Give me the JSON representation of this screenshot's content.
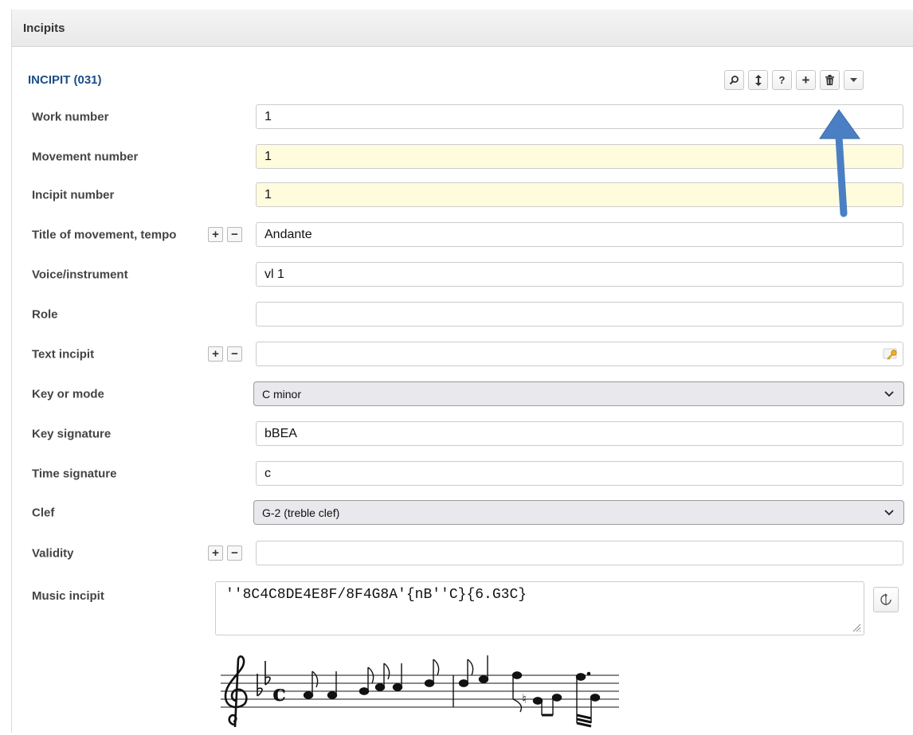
{
  "panel": {
    "title": "Incipits"
  },
  "section": {
    "title": "INCIPIT (031)"
  },
  "toolbar": {
    "buttons": [
      {
        "icon": "search-icon",
        "glyph": "⌕"
      },
      {
        "icon": "move-icon",
        "glyph": "↕"
      },
      {
        "icon": "help-icon",
        "glyph": "?"
      },
      {
        "icon": "plus-icon",
        "glyph": "+"
      },
      {
        "icon": "trash-icon",
        "glyph": "🗑"
      },
      {
        "icon": "caret-down-icon",
        "glyph": "▾"
      }
    ]
  },
  "fields": {
    "work_number": {
      "label": "Work number",
      "value": "1"
    },
    "movement_number": {
      "label": "Movement number",
      "value": "1"
    },
    "incipit_number": {
      "label": "Incipit number",
      "value": "1"
    },
    "title_movement": {
      "label": "Title of movement, tempo",
      "value": "Andante"
    },
    "voice_instrument": {
      "label": "Voice/instrument",
      "value": "vl 1"
    },
    "role": {
      "label": "Role",
      "value": ""
    },
    "text_incipit": {
      "label": "Text incipit",
      "value": ""
    },
    "key_mode": {
      "label": "Key or mode",
      "value": "C minor"
    },
    "key_signature": {
      "label": "Key signature",
      "value": "bBEA"
    },
    "time_signature": {
      "label": "Time signature",
      "value": "c"
    },
    "clef": {
      "label": "Clef",
      "value": "G-2 (treble clef)"
    },
    "validity": {
      "label": "Validity",
      "value": ""
    },
    "music_incipit": {
      "label": "Music incipit",
      "value": "''8C4C8DE4E8F/8F4G8A'{nB''C}{6.G3C}"
    }
  },
  "pm": {
    "plus": "+",
    "minus": "−"
  },
  "colors": {
    "accent": "#1c4e86",
    "required_field": "#fefcdc",
    "arrow": "#4a7fc4"
  }
}
